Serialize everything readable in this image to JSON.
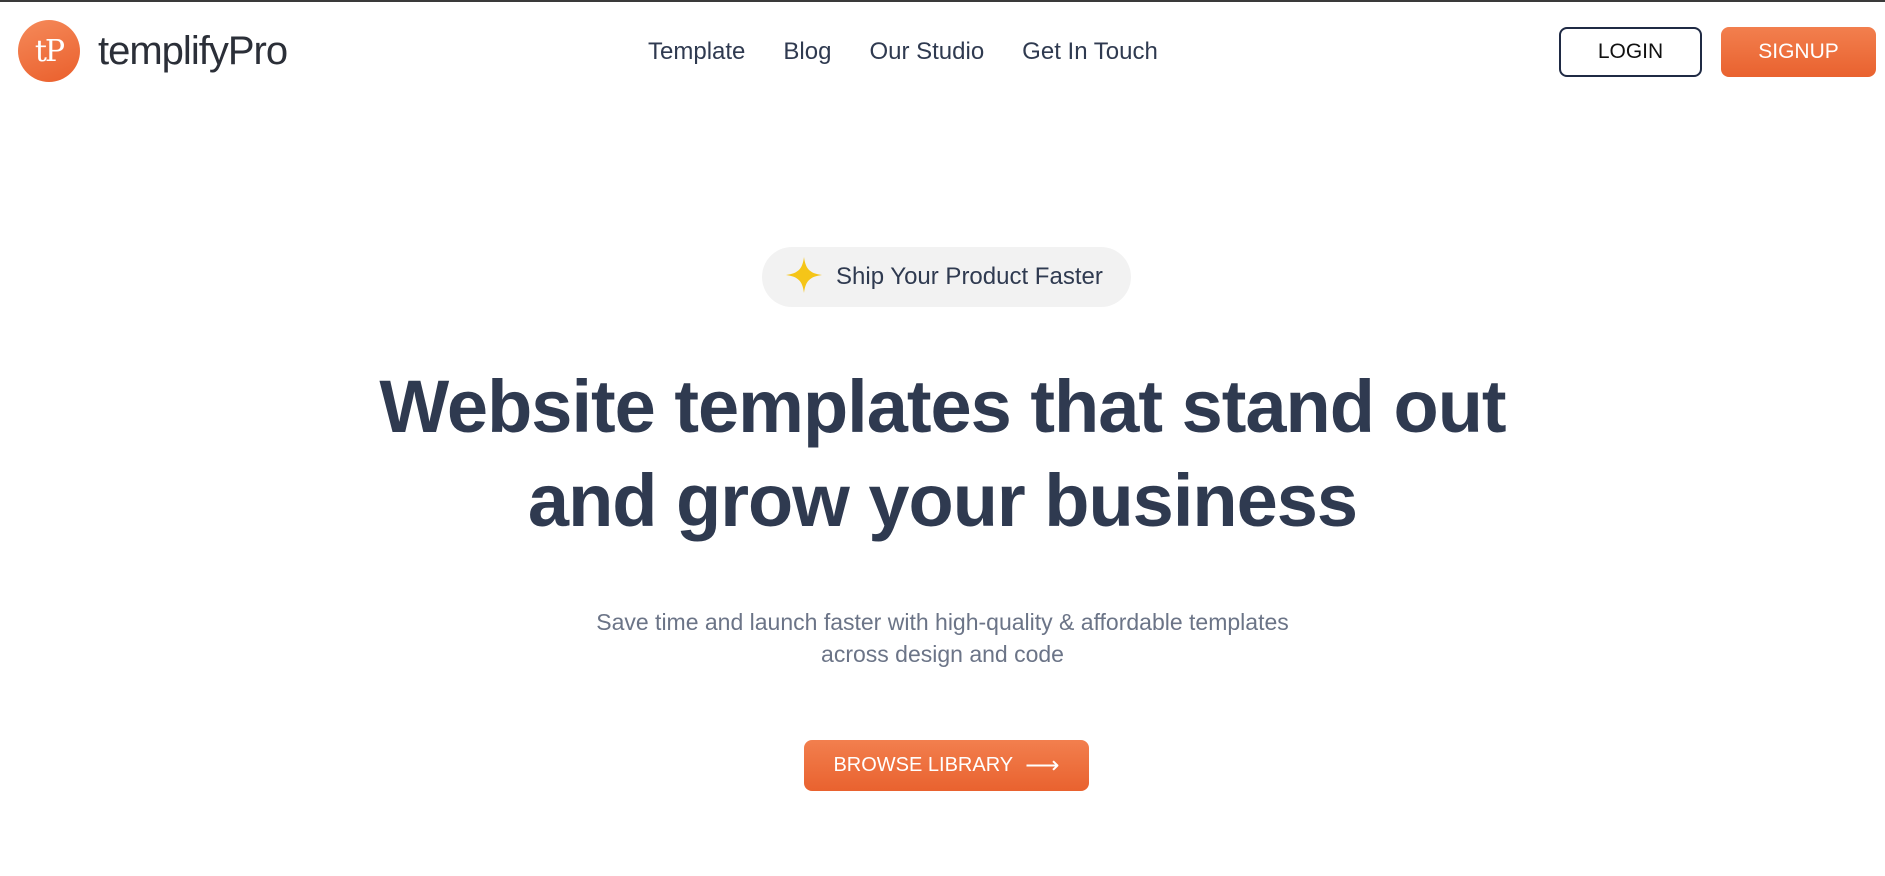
{
  "brand": {
    "logo_mark": "tP",
    "name": "templifyPro"
  },
  "nav": {
    "items": [
      {
        "label": "Template"
      },
      {
        "label": "Blog"
      },
      {
        "label": "Our Studio"
      },
      {
        "label": "Get In Touch"
      }
    ]
  },
  "auth": {
    "login_label": "LOGIN",
    "signup_label": "SIGNUP"
  },
  "hero": {
    "badge_icon": "sparkle-icon",
    "badge_text": "Ship Your Product Faster",
    "headline_line1": "Website templates that stand out",
    "headline_line2": "and grow your business",
    "subtext_line1": "Save time and launch faster with high-quality & affordable templates",
    "subtext_line2": "across design and code",
    "cta_label": "BROWSE LIBRARY",
    "cta_icon": "arrow-right-icon",
    "cta_arrow": "⟶"
  },
  "colors": {
    "accent": "#ec6a36",
    "text_dark": "#2f3a50",
    "text_muted": "#6b7487",
    "badge_bg": "#f2f2f2",
    "sparkle": "#f5c518"
  }
}
